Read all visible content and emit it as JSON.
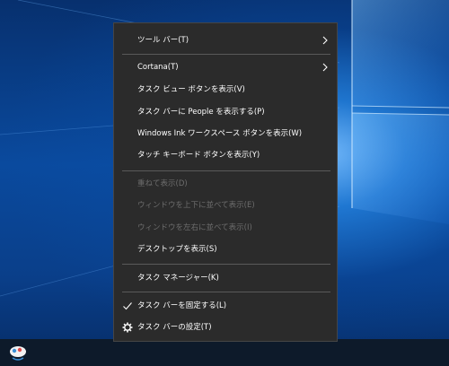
{
  "context_menu": {
    "items": [
      {
        "label": "ツール バー(T)",
        "has_submenu": true
      },
      {
        "label": "Cortana(T)",
        "has_submenu": true
      },
      {
        "label": "タスク ビュー ボタンを表示(V)"
      },
      {
        "label": "タスク バーに People を表示する(P)"
      },
      {
        "label": "Windows Ink ワークスペース ボタンを表示(W)"
      },
      {
        "label": "タッチ キーボード ボタンを表示(Y)"
      },
      {
        "label": "重ねて表示(D)",
        "disabled": true
      },
      {
        "label": "ウィンドウを上下に並べて表示(E)",
        "disabled": true
      },
      {
        "label": "ウィンドウを左右に並べて表示(I)",
        "disabled": true
      },
      {
        "label": "デスクトップを表示(S)"
      },
      {
        "label": "タスク マネージャー(K)"
      },
      {
        "label": "タスク バーを固定する(L)",
        "checked": true
      },
      {
        "label": "タスク バーの設定(T)",
        "icon": "gear-icon"
      }
    ]
  },
  "colors": {
    "menu_background": "#2b2b2b",
    "menu_text": "#ffffff",
    "menu_disabled_text": "#6d6d6d",
    "separator": "#5a5a5a",
    "taskbar": "#0d1a2a"
  }
}
